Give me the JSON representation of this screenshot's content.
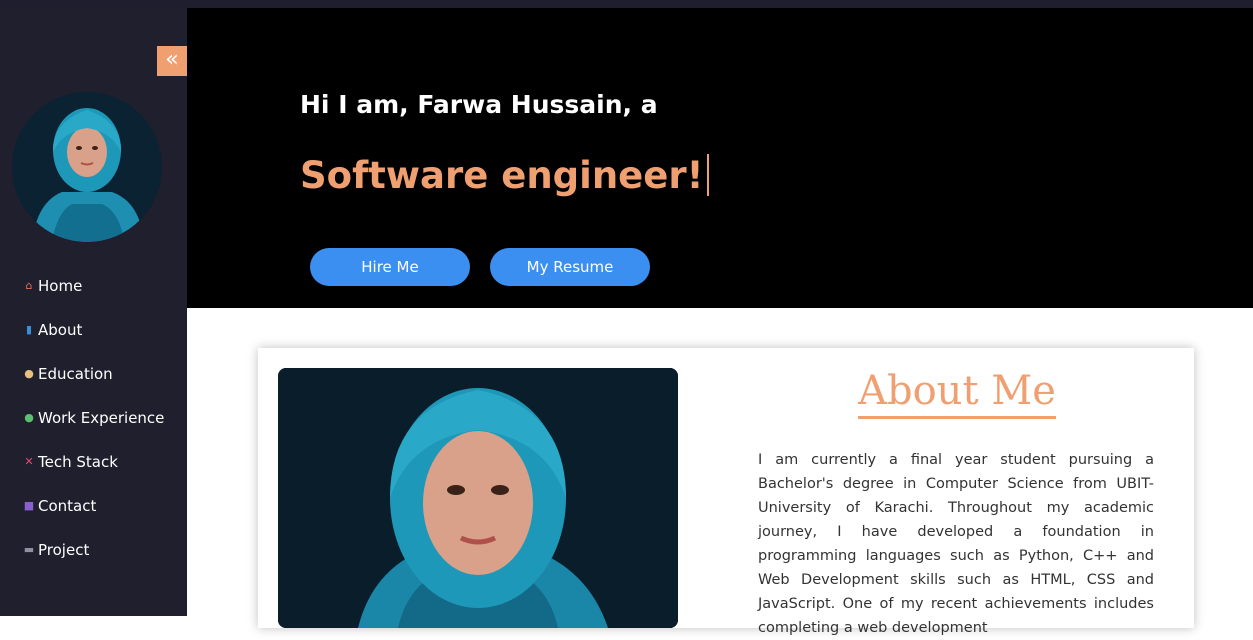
{
  "sidebar": {
    "collapse_label": "«",
    "profile_alt": "Farwa Hussain",
    "items": [
      {
        "label": "Home",
        "icon": "home-icon"
      },
      {
        "label": "About",
        "icon": "info-icon"
      },
      {
        "label": "Education",
        "icon": "student-icon"
      },
      {
        "label": "Work Experience",
        "icon": "worker-icon"
      },
      {
        "label": "Tech Stack",
        "icon": "tools-icon"
      },
      {
        "label": "Contact",
        "icon": "contact-icon"
      },
      {
        "label": "Project",
        "icon": "project-icon"
      }
    ]
  },
  "hero": {
    "greeting": "Hi I am, Farwa Hussain, a",
    "role": "Software engineer!",
    "hire_label": "Hire Me",
    "resume_label": "My Resume"
  },
  "about": {
    "title": "About Me",
    "text": "I am currently a final year student pursuing a Bachelor's degree in Computer Science from UBIT- University of Karachi. Throughout my academic journey, I have developed a foundation in programming languages such as Python, C++ and Web Development skills such as HTML, CSS and JavaScript. One of my recent achievements includes completing a web development"
  },
  "colors": {
    "accent": "#f0a070",
    "button": "#3b8ff0",
    "sidebar_bg": "#1f1f2d",
    "hero_bg": "#000000"
  }
}
